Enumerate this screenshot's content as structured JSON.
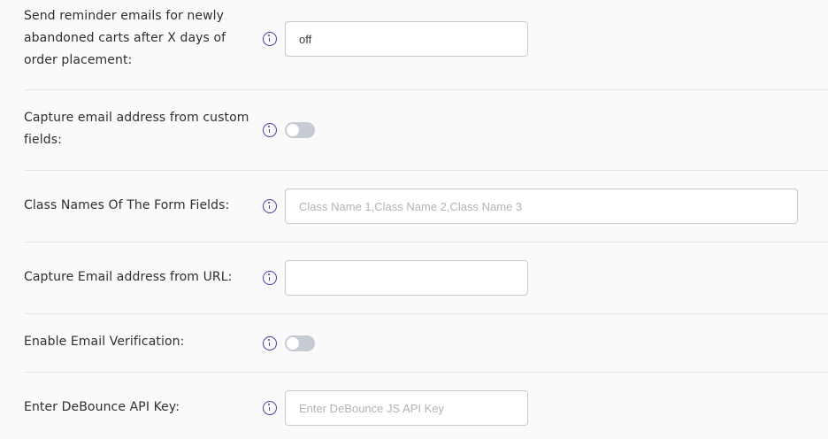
{
  "settings": {
    "reminder_days": {
      "label": "Send reminder emails for newly abandoned carts after X days of order placement:",
      "value": "off"
    },
    "capture_custom_fields": {
      "label": "Capture email address from custom fields:",
      "enabled": false
    },
    "class_names": {
      "label": "Class Names Of The Form Fields:",
      "value": "",
      "placeholder": "Class Name 1,Class Name 2,Class Name 3"
    },
    "capture_from_url": {
      "label": "Capture Email address from URL:",
      "value": ""
    },
    "email_verification": {
      "label": "Enable Email Verification:",
      "enabled": false
    },
    "debounce_api_key": {
      "label": "Enter DeBounce API Key:",
      "value": "",
      "placeholder": "Enter DeBounce JS API Key"
    }
  },
  "colors": {
    "accent": "#4b3aa4",
    "toggle_off": "#c7ccd4",
    "divider": "#e6e6e6",
    "background": "#fafafa"
  },
  "icons": {
    "info": "info-circle-icon"
  }
}
